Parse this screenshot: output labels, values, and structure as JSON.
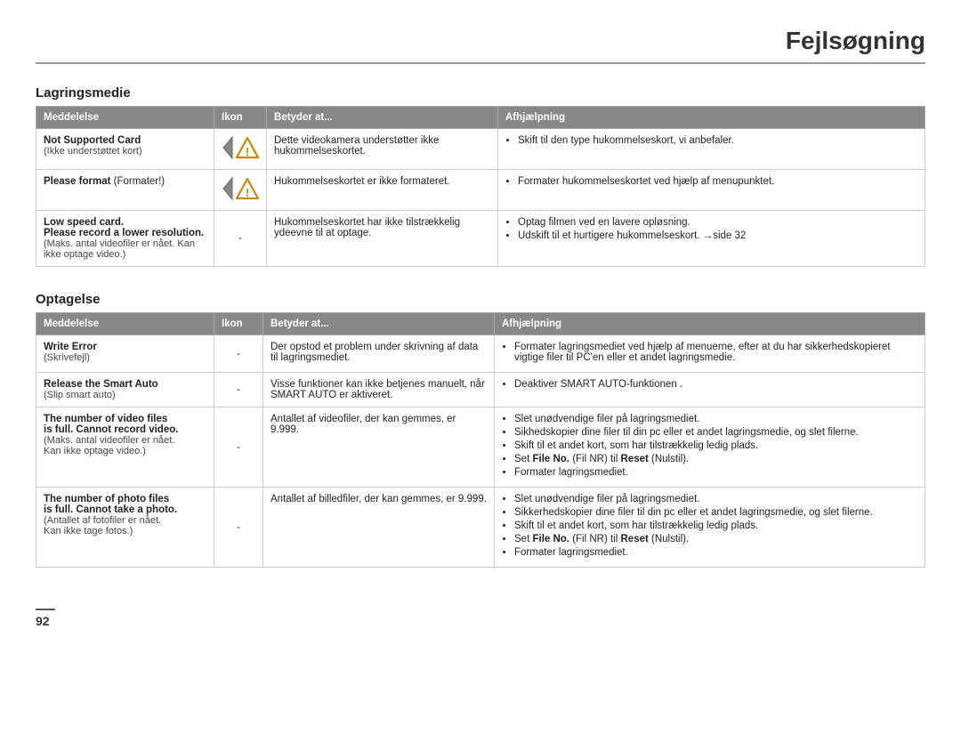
{
  "page": {
    "title": "Fejlsøgning",
    "page_number": "92"
  },
  "sections": [
    {
      "id": "lagringsmedie",
      "title": "Lagringsmedie",
      "columns": [
        "Meddelelse",
        "Ikon",
        "Betyder at...",
        "Afhjælpning"
      ],
      "rows": [
        {
          "message_bold": "Not Supported Card",
          "message_small": "(Ikke understøttet kort)",
          "icon": "warning",
          "means": "Dette videokamera understøtter ikke hukommelseskortet.",
          "help": [
            "Skift til den type hukommelseskort, vi anbefaler."
          ]
        },
        {
          "message_bold": "Please format",
          "message_bold_suffix": " (Formater!)",
          "icon": "warning",
          "means": "Hukommelseskortet er ikke formateret.",
          "help": [
            "Formater hukommelseskortet ved hjælp af menupunktet."
          ]
        },
        {
          "message_bold": "Low speed card.\nPlease record a lower resolution.",
          "message_small": "(Maks. antal videofiler er nået. Kan ikke optage video.)",
          "icon": "-",
          "means": "Hukommelseskortet har ikke tilstrækkelig ydeevne til at optage.",
          "help": [
            "Optag filmen ved en lavere opløsning.",
            "Udskift til et hurtigere hukommelseskort. →side 32"
          ]
        }
      ]
    },
    {
      "id": "optagelse",
      "title": "Optagelse",
      "columns": [
        "Meddelelse",
        "Ikon",
        "Betyder at...",
        "Afhjælpning"
      ],
      "rows": [
        {
          "message_bold": "Write Error",
          "message_small": "(Skrivefejl)",
          "icon": "-",
          "means": "Der opstod et problem under skrivning af data til lagringsmediet.",
          "help": [
            "Formater lagringsmediet ved hjælp af menuerne, efter at du har sikkerhedskopieret vigtige filer til PC'en eller et andet lagringsmedie."
          ]
        },
        {
          "message_bold": "Release the Smart Auto",
          "message_small": "(Slip smart auto)",
          "icon": "-",
          "means": "Visse funktioner kan ikke betjenes manuelt, når SMART AUTO er aktiveret.",
          "help": [
            "Deaktiver SMART AUTO-funktionen ."
          ]
        },
        {
          "message_bold": "The number of video files\nis full. Cannot record video.",
          "message_small": "(Maks. antal videofiler er nået.\nKan ikke optage video.)",
          "icon": "-",
          "means": "Antallet af videofiler, der kan gemmes, er 9.999.",
          "help": [
            "Slet unødvendige filer på lagringsmediet.",
            "Sikhedskopier dine filer til din pc eller et andet lagringsmedie, og slet filerne.",
            "Skift til et andet kort, som har tilstrækkelig ledig plads.",
            "Set File No. (Fil NR) til Reset (Nulstil).",
            "Formater lagringsmediet."
          ]
        },
        {
          "message_bold": "The number of photo files\nis full. Cannot take a photo.",
          "message_small": "(Antallet af fotofiler er nået.\nKan ikke tage fotos.)",
          "icon": "-",
          "means": "Antallet af billedfiler, der kan gemmes, er 9.999.",
          "help": [
            "Slet unødvendige filer på lagringsmediet.",
            "Sikkerhedskopier dine filer til din pc eller et andet lagringsmedie, og slet filerne.",
            "Skift til et andet kort, som har tilstrækkelig ledig plads.",
            "Set File No. (Fil NR) til Reset (Nulstil).",
            "Formater lagringsmediet."
          ]
        }
      ]
    }
  ]
}
